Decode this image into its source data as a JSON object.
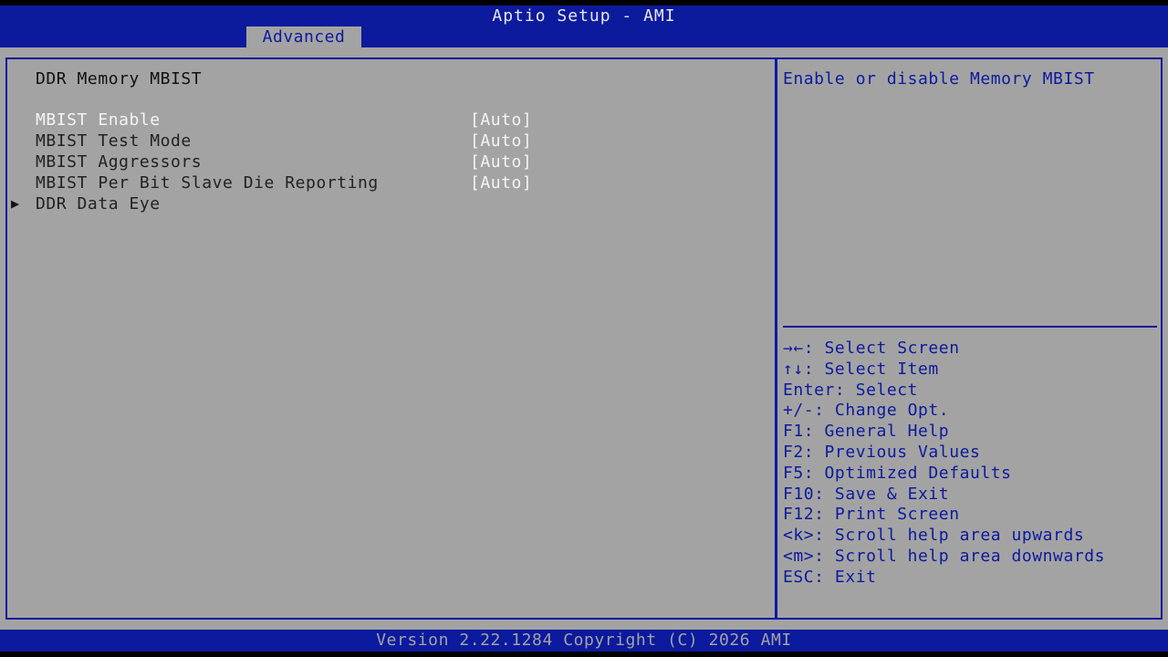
{
  "header": {
    "title": "Aptio Setup - AMI",
    "tabs": [
      {
        "label": "Advanced",
        "active": true
      }
    ]
  },
  "main": {
    "section_title": "DDR Memory MBIST",
    "items": [
      {
        "label": "MBIST Enable",
        "value": "[Auto]",
        "selected": true
      },
      {
        "label": "MBIST Test Mode",
        "value": "[Auto]"
      },
      {
        "label": "MBIST Aggressors",
        "value": "[Auto]"
      },
      {
        "label": "MBIST Per Bit Slave Die Reporting",
        "value": "[Auto]"
      },
      {
        "label": "DDR Data Eye",
        "submenu": true,
        "arrow": "▶"
      }
    ]
  },
  "help": {
    "text": "Enable or disable Memory MBIST",
    "keys": [
      "→←: Select Screen",
      "↑↓: Select Item",
      "Enter: Select",
      "+/-: Change Opt.",
      "F1: General Help",
      "F2: Previous Values",
      "F5: Optimized Defaults",
      "F10: Save & Exit",
      "F12: Print Screen",
      "<k>: Scroll help area upwards",
      "<m>: Scroll help area downwards",
      "ESC: Exit"
    ]
  },
  "footer": {
    "version": "Version 2.22.1284 Copyright (C) 2026 AMI"
  },
  "colors": {
    "background": "#a3a3a3",
    "accent": "#0c1a9e",
    "highlight_text": "#f4f4f4"
  }
}
